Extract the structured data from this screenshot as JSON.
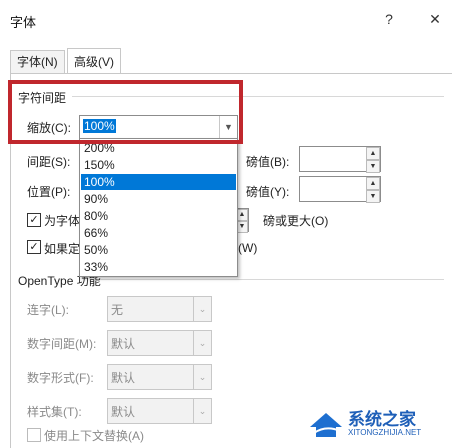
{
  "window": {
    "title": "字体",
    "help_glyph": "?",
    "close_glyph": "✕"
  },
  "tabs": [
    {
      "label": "字体(N)"
    },
    {
      "label": "高级(V)"
    }
  ],
  "spacing_section": {
    "heading": "字符间距",
    "scale_label": "缩放(C):",
    "scale_value": "100%",
    "spacing_label": "间距(S):",
    "position_label": "位置(P):",
    "pt_label_1": "磅值(B):",
    "pt_label_2": "磅值(Y):",
    "kerning_label": "为字体",
    "kerning_suffix": "磅或更大(O)",
    "grid_label": "如果定",
    "grid_suffix": "(W)"
  },
  "scale_options": [
    "200%",
    "150%",
    "100%",
    "90%",
    "80%",
    "66%",
    "50%",
    "33%"
  ],
  "scale_selected_index": 2,
  "opentype_section": {
    "heading": "OpenType 功能",
    "ligatures_label": "连字(L):",
    "ligatures_value": "无",
    "num_spacing_label": "数字间距(M):",
    "num_spacing_value": "默认",
    "num_forms_label": "数字形式(F):",
    "num_forms_value": "默认",
    "style_sets_label": "样式集(T):",
    "style_sets_value": "默认",
    "contextual_label": "使用上下文替换(A)"
  },
  "watermark": {
    "brand": "系统之家",
    "url": "XITONGZHIJIA.NET"
  },
  "colors": {
    "accent": "#0078d7",
    "highlight": "#c0272d"
  }
}
